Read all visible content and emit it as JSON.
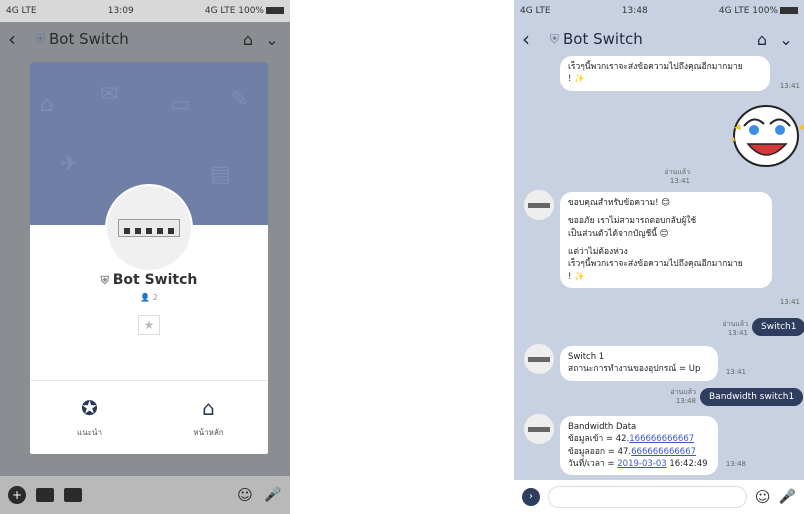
{
  "left_phone": {
    "status": {
      "network": "4G LTE",
      "time": "13:09",
      "battery": "4G LTE 100%"
    },
    "header": {
      "title": "Bot Switch"
    },
    "modal": {
      "name": "Bot Switch",
      "followers": "2",
      "actions": [
        {
          "label": "แนะนำ"
        },
        {
          "label": "หน้าหลัก"
        }
      ]
    }
  },
  "right_phone": {
    "status": {
      "network": "4G LTE",
      "time": "13:48",
      "battery": "4G LTE 100%"
    },
    "header": {
      "title": "Bot Switch"
    },
    "messages": {
      "m1_text": "เร็วๆนี้พวกเราจะส่งข้อความไปถึงคุณอีกมากมาย",
      "m1_emoji": "! ✨",
      "m1_time": "13:41",
      "sticker_read": "อ่านแล้ว",
      "sticker_time": "13:41",
      "m2_line1": "ขอบคุณสำหรับข้อความ! 😊",
      "m2_line2": "ขออภัย เราไม่สามารถตอบกลับผู้ใช้",
      "m2_line3": "เป็นส่วนตัวได้จากบัญชีนี้ 😊",
      "m2_line4": "แต่ว่าไม่ต้องห่วง",
      "m2_line5": "เร็วๆนี้พวกเราจะส่งข้อความไปถึงคุณอีกมากมาย",
      "m2_line6": "! ✨",
      "m2_time": "13:41",
      "out1_read": "อ่านแล้ว",
      "out1_time": "13:41",
      "out1_text": "Switch1",
      "m3_line1": "Switch 1",
      "m3_line2": "สถานะการทำงานของอุปกรณ์ = Up",
      "m3_time": "13:41",
      "out2_read": "อ่านแล้ว",
      "out2_time": "13:48",
      "out2_text": "Bandwidth switch1",
      "m4_line1": "Bandwidth Data",
      "m4_in_label": "ข้อมูลเข้า = 42.",
      "m4_in_link": "166666666667",
      "m4_out_label": "ข้อมูลออก = 47.",
      "m4_out_link": "666666666667",
      "m4_date_label": "วันที่/เวลา = ",
      "m4_date_link": "2019-03-03",
      "m4_date_time": " 16:42:49",
      "m4_time": "13:48"
    }
  }
}
